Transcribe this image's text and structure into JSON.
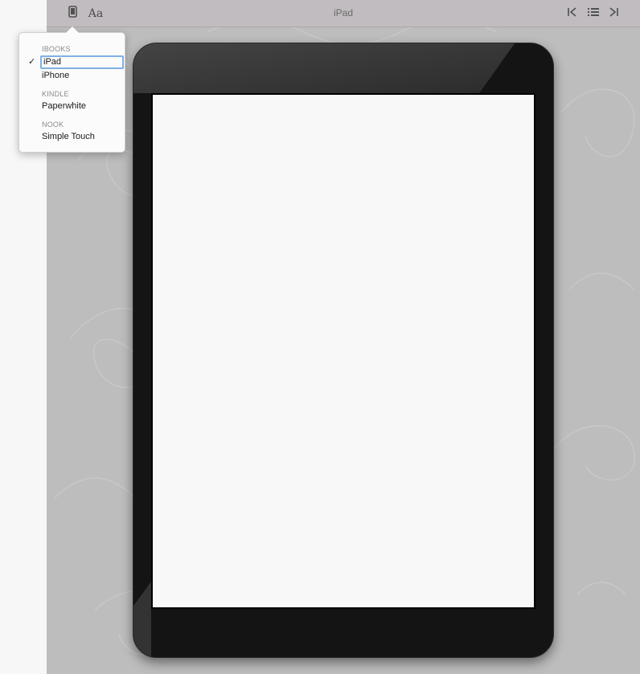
{
  "toolbar": {
    "title": "iPad",
    "device_icon": "device-phone-icon",
    "font_label": "Aa",
    "first_icon": "skip-first-icon",
    "toc_icon": "list-icon",
    "last_icon": "skip-last-icon"
  },
  "device_menu": {
    "groups": [
      {
        "label": "IBOOKS",
        "items": [
          {
            "label": "iPad",
            "selected": true
          },
          {
            "label": "iPhone"
          }
        ]
      },
      {
        "label": "KINDLE",
        "items": [
          {
            "label": "Paperwhite"
          }
        ]
      },
      {
        "label": "NOOK",
        "items": [
          {
            "label": "Simple Touch"
          }
        ]
      }
    ],
    "check_mark": "✓"
  },
  "colors": {
    "toolbar_bg": "#c0bcbf",
    "stage_bg": "#bdbdbd",
    "device_bezel": "#141414",
    "screen_bg": "#f8f8f8",
    "selection_ring": "#7fb0e4"
  }
}
